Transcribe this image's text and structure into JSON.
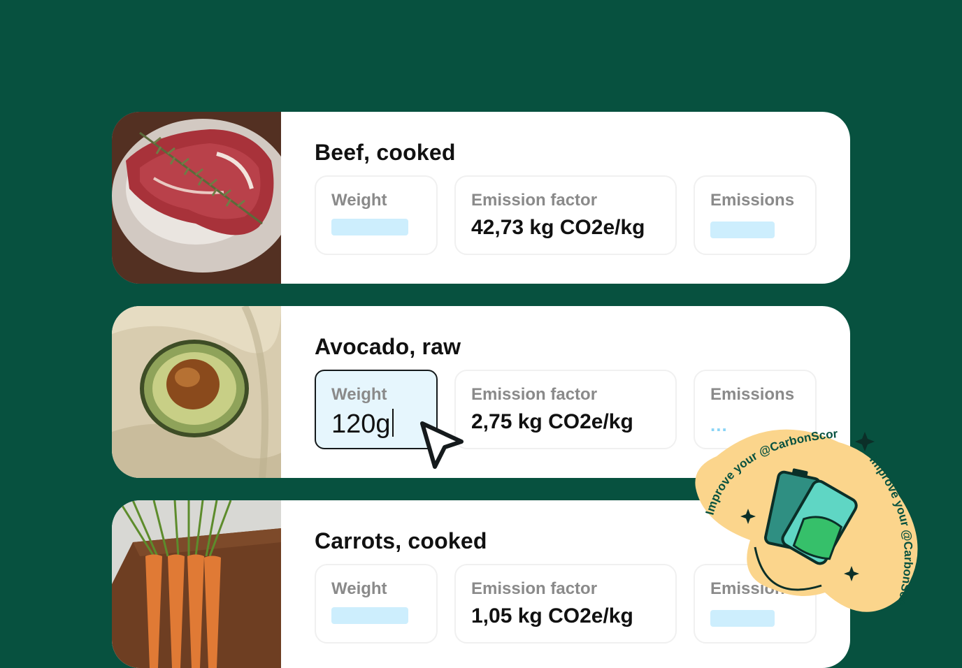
{
  "labels": {
    "weight": "Weight",
    "emission_factor": "Emission factor",
    "emissions": "Emissions"
  },
  "items": [
    {
      "name": "Beef, cooked",
      "weight": "",
      "emission_factor": "42,73 kg CO2e/kg",
      "emissions": ""
    },
    {
      "name": "Avocado, raw",
      "weight": "120g",
      "emission_factor": "2,75 kg CO2e/kg",
      "emissions": "..."
    },
    {
      "name": "Carrots, cooked",
      "weight": "",
      "emission_factor": "1,05 kg CO2e/kg",
      "emissions": ""
    }
  ],
  "sticker": {
    "text": "Improve your @CarbonScore",
    "icon": "battery-icon",
    "color": "#fbd58c"
  },
  "colors": {
    "background": "#07513f",
    "placeholder": "#cdeefd",
    "active_field": "#e6f6fd"
  }
}
